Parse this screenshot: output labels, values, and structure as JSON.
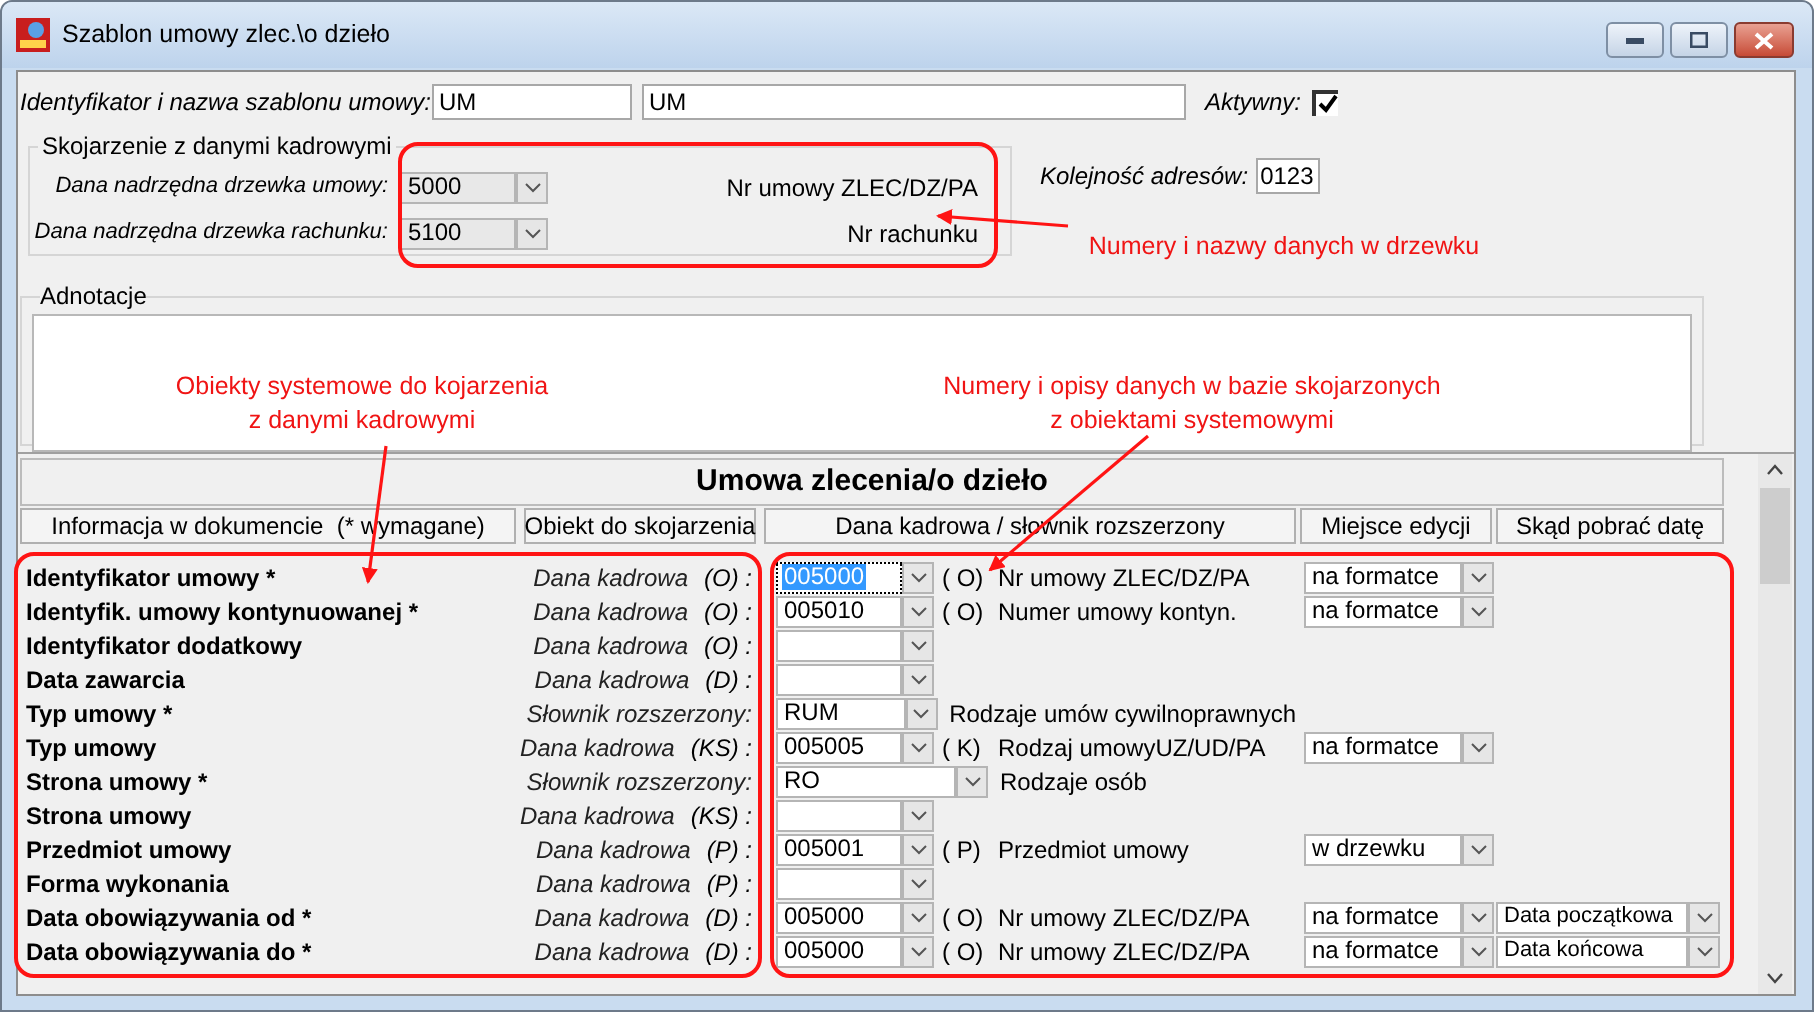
{
  "window": {
    "title": "Szablon umowy zlec.\\o dzieło"
  },
  "template": {
    "label": "Identyfikator i nazwa szablonu umowy:",
    "id": "UM",
    "name": "UM"
  },
  "active": {
    "label": "Aktywny:",
    "checked": true
  },
  "link_group": {
    "legend": "Skojarzenie z danymi kadrowymi",
    "rows": [
      {
        "label": "Dana nadrzędna drzewka umowy:",
        "value": "5000",
        "description": "Nr umowy ZLEC/DZ/PA"
      },
      {
        "label": "Dana nadrzędna drzewka rachunku:",
        "value": "5100",
        "description": "Nr rachunku"
      }
    ]
  },
  "address_order": {
    "label": "Kolejność adresów:",
    "value": "0123"
  },
  "notes": {
    "legend": "Adnotacje"
  },
  "table": {
    "title": "Umowa zlecenia/o dzieło",
    "columns": [
      "Informacja w dokumencie  (* wymagane)",
      "Obiekt do skojarzenia",
      "Dana kadrowa / słownik rozszerzony",
      "Miejsce edycji",
      "Skąd pobrać datę"
    ],
    "rows": [
      {
        "name": "Identyfikator umowy *",
        "object": "Dana kadrowa",
        "object_code": "(O) :",
        "kind": "data",
        "value": "005000",
        "selected": true,
        "code": "( O)",
        "description": "Nr umowy ZLEC/DZ/PA",
        "edit_place": "na formatce"
      },
      {
        "name": "Identyfik. umowy kontynuowanej *",
        "object": "Dana kadrowa",
        "object_code": "(O) :",
        "kind": "data",
        "value": "005010",
        "selected": false,
        "code": "( O)",
        "description": "Numer umowy kontyn.",
        "edit_place": "na formatce"
      },
      {
        "name": "Identyfikator dodatkowy",
        "object": "Dana kadrowa",
        "object_code": "(O) :",
        "kind": "data",
        "selected": false
      },
      {
        "name": "Data zawarcia",
        "object": "Dana kadrowa",
        "object_code": "(D) :",
        "kind": "data",
        "selected": false
      },
      {
        "name": "Typ umowy *",
        "object": "Słownik rozszerzony:",
        "kind": "dictionary",
        "value": "RUM",
        "selected": false,
        "description": "Rodzaje umów cywilnoprawnych"
      },
      {
        "name": "Typ umowy",
        "object": "Dana kadrowa",
        "object_code": "(KS) :",
        "kind": "data",
        "value": "005005",
        "selected": false,
        "code": "( K)",
        "description": "Rodzaj umowyUZ/UD/PA",
        "edit_place": "na formatce"
      },
      {
        "name": "Strona umowy *",
        "object": "Słownik rozszerzony:",
        "kind": "dictionary",
        "value": "RO",
        "selected": false,
        "description": "Rodzaje osób"
      },
      {
        "name": "Strona umowy",
        "object": "Dana kadrowa",
        "object_code": "(KS) :",
        "kind": "data",
        "selected": false
      },
      {
        "name": "Przedmiot umowy",
        "object": "Dana kadrowa",
        "object_code": "(P) :",
        "kind": "data",
        "value": "005001",
        "selected": false,
        "code": "( P)",
        "description": "Przedmiot umowy",
        "edit_place": "w drzewku"
      },
      {
        "name": "Forma wykonania",
        "object": "Dana kadrowa",
        "object_code": "(P) :",
        "kind": "data",
        "selected": false
      },
      {
        "name": "Data obowiązywania od *",
        "object": "Dana kadrowa",
        "object_code": "(D) :",
        "kind": "data",
        "value": "005000",
        "selected": false,
        "code": "( O)",
        "description": "Nr umowy ZLEC/DZ/PA",
        "edit_place": "na formatce",
        "date_source": "Data początkowa"
      },
      {
        "name": "Data obowiązywania do *",
        "object": "Dana kadrowa",
        "object_code": "(D) :",
        "kind": "data",
        "value": "005000",
        "selected": false,
        "code": "( O)",
        "description": "Nr umowy ZLEC/DZ/PA",
        "edit_place": "na formatce",
        "date_source": "Data końcowa"
      }
    ]
  },
  "annotations": [
    {
      "lines": [
        "Numery i nazwy danych w drzewku"
      ]
    },
    {
      "lines": [
        "Obiekty systemowe do kojarzenia",
        "z danymi kadrowymi"
      ]
    },
    {
      "lines": [
        "Numery i opisy danych w bazie skojarzonych",
        "z obiektami systemowymi"
      ]
    }
  ]
}
